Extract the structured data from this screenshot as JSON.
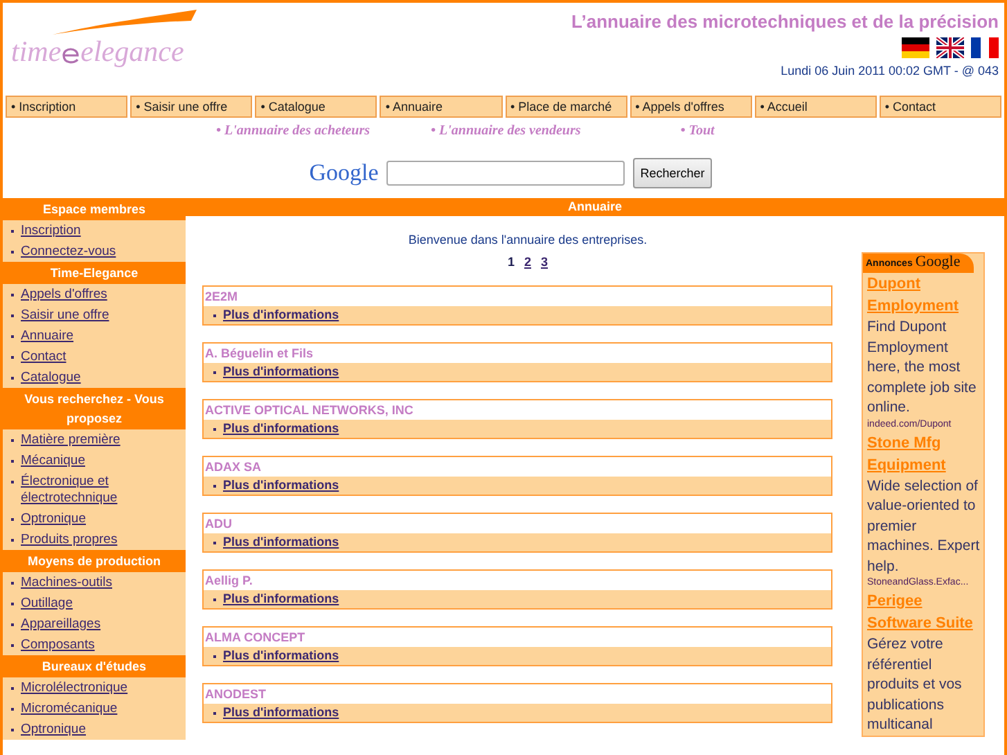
{
  "header": {
    "logo": {
      "left": "time",
      "right": "elegance"
    },
    "tagline": "L’annuaire des microtechniques et de la précision",
    "flags": [
      {
        "kind": "german"
      },
      {
        "kind": "english"
      },
      {
        "kind": "french"
      }
    ],
    "date": "Lundi 06 Juin 2011 00:02 GMT - @ 043"
  },
  "nav": [
    "• Inscription",
    "• Saisir une offre",
    "• Catalogue",
    "• Annuaire",
    "• Place de marché",
    "• Appels d'offres",
    "• Accueil",
    "• Contact"
  ],
  "sub_links": [
    "• L'annuaire des acheteurs",
    "• L'annuaire des vendeurs",
    "• Tout"
  ],
  "search": {
    "logo": "Google",
    "button": "Rechercher"
  },
  "sidebar": [
    {
      "title": "Espace membres",
      "items": [
        "Inscription",
        "Connectez-vous"
      ]
    },
    {
      "title": "Time-Elegance",
      "items": [
        "Appels d'offres",
        "Saisir une offre",
        "Annuaire",
        "Contact",
        "Catalogue"
      ]
    },
    {
      "title": "Vous recherchez - Vous proposez",
      "items": [
        "Matière première",
        "Mécanique",
        "Électronique et électrotechnique",
        "Optronique",
        "Produits propres"
      ]
    },
    {
      "title": "Moyens de production",
      "items": [
        "Machines-outils",
        "Outillage",
        "Appareillages",
        "Composants"
      ]
    },
    {
      "title": "Bureaux d'études",
      "items": [
        "Microlélectronique",
        "Micromécanique",
        "Optronique"
      ]
    }
  ],
  "main": {
    "title": "Annuaire",
    "welcome": "Bienvenue dans l'annuaire des entreprises.",
    "pages": [
      {
        "label": "1",
        "selected": true
      },
      {
        "label": "2",
        "selected": false
      },
      {
        "label": "3",
        "selected": false
      }
    ],
    "entries": [
      {
        "name": "2E2M",
        "link": "Plus d'informations"
      },
      {
        "name": "A. Béguelin et Fils",
        "link": "Plus d'informations"
      },
      {
        "name": "ACTIVE OPTICAL NETWORKS, INC",
        "link": "Plus d'informations"
      },
      {
        "name": "ADAX SA",
        "link": "Plus d'informations"
      },
      {
        "name": "ADU",
        "link": "Plus d'informations"
      },
      {
        "name": "Aellig P.",
        "link": "Plus d'informations"
      },
      {
        "name": "ALMA CONCEPT",
        "link": "Plus d'informations"
      },
      {
        "name": "ANODEST",
        "link": "Plus d'informations"
      }
    ]
  },
  "ads": {
    "label": "Annonces",
    "brand": "Google",
    "items": [
      {
        "title": "Dupont Employment",
        "text": "Find Dupont Employment here, the most complete job site online.",
        "url": "indeed.com/Dupont"
      },
      {
        "title": "Stone Mfg Equipment",
        "text": "Wide selection of value-oriented to premier machines. Expert help.",
        "url": "StoneandGlass.Exfac..."
      },
      {
        "title": "Perigee Software Suite",
        "text": "Gérez votre référentiel produits et vos publications multicanal"
      }
    ]
  }
}
